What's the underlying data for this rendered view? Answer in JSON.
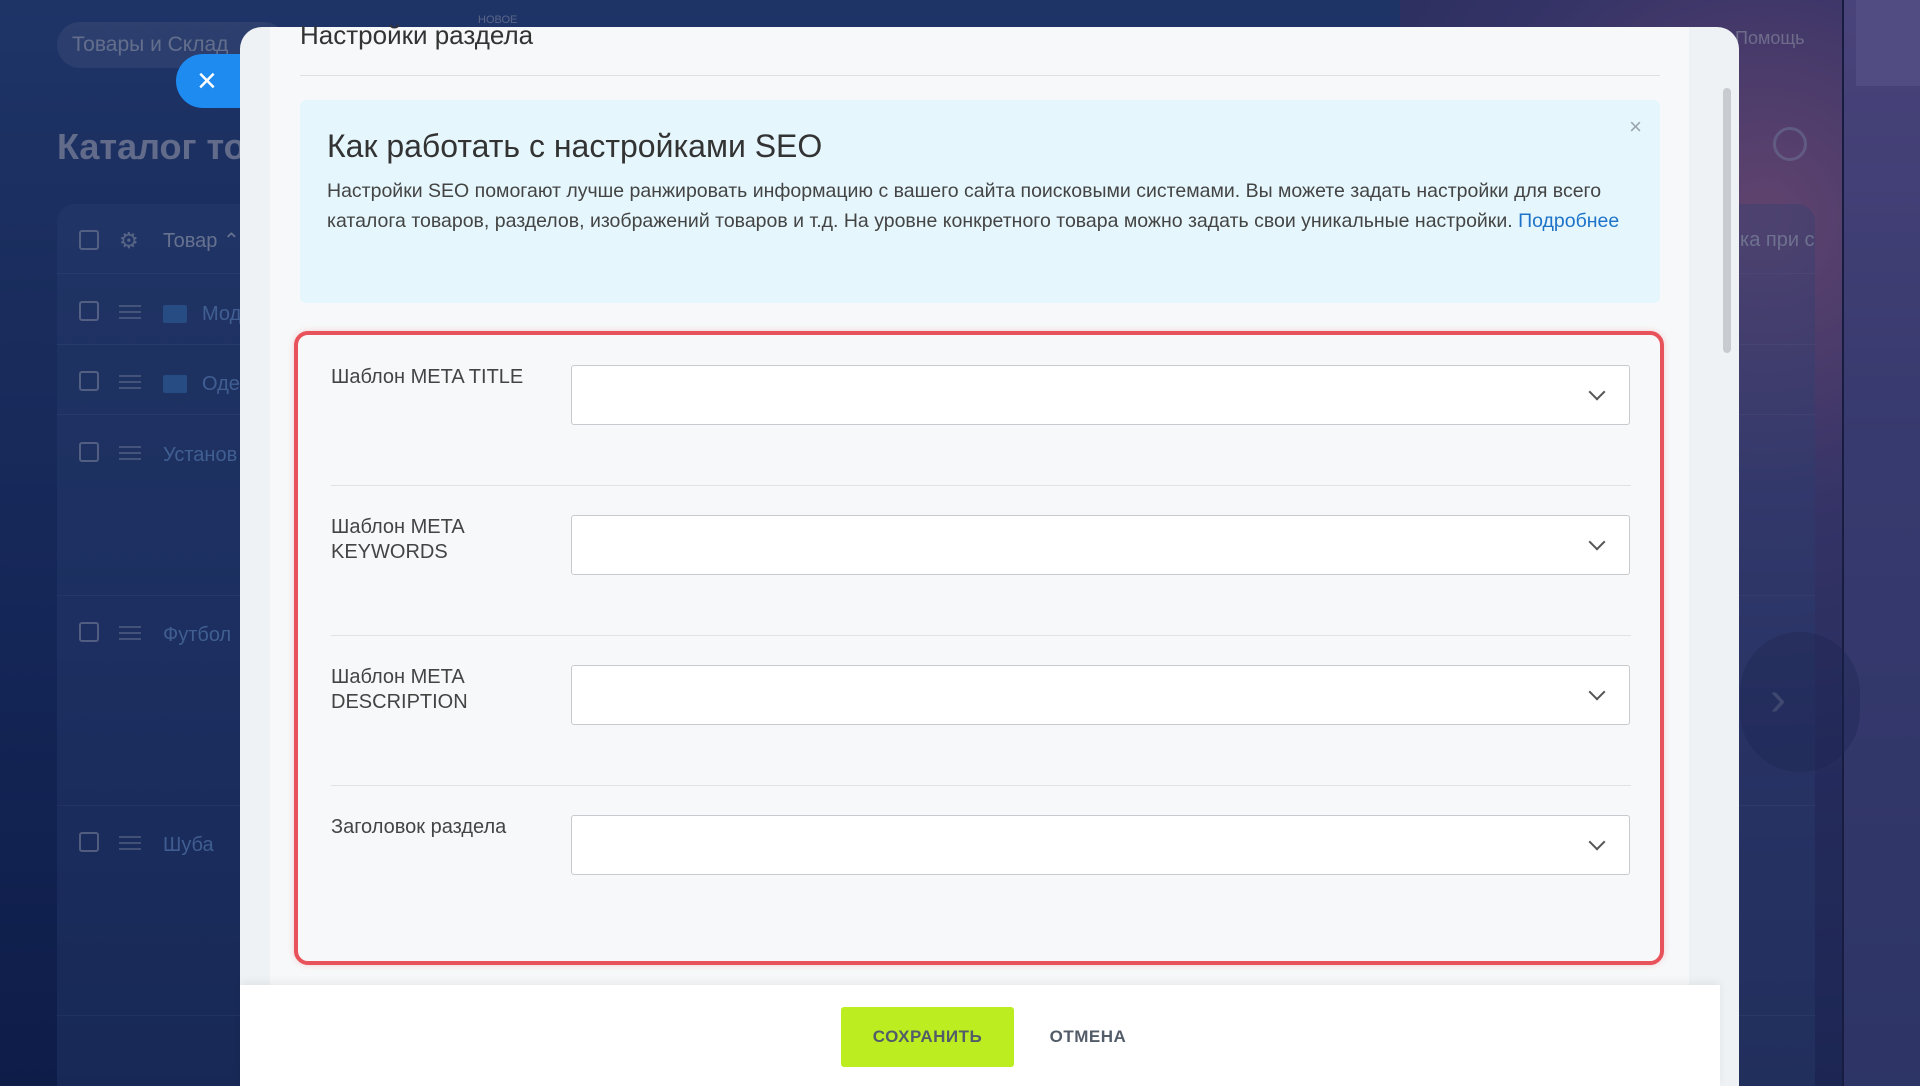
{
  "background": {
    "search_text": "Товары и Склад",
    "new_badge": "НОВОЕ",
    "help_text": "Помощь",
    "page_title": "Каталог то",
    "header": {
      "column_product": "Товар",
      "right_column": "ка при с"
    },
    "rows": [
      {
        "label": "Мод"
      },
      {
        "label": "Оде"
      },
      {
        "label": "Установ"
      },
      {
        "label": "Футбол"
      },
      {
        "label": "Шуба"
      }
    ]
  },
  "close_icon": "×",
  "modal": {
    "section_title": "Настройки раздела",
    "info": {
      "title": "Как работать с настройками SEO",
      "text": "Настройки SEO помогают лучше ранжировать информацию с вашего сайта поисковыми системами. Вы можете задать настройки для всего каталога товаров, разделов, изображений товаров и т.д. На уровне конкретного товара можно задать свои уникальные настройки.",
      "link": "Подробнее",
      "close": "×"
    },
    "fields": [
      {
        "label": "Шаблон META TITLE",
        "value": ""
      },
      {
        "label": "Шаблон META KEYWORDS",
        "value": ""
      },
      {
        "label": "Шаблон META DESCRIPTION",
        "value": ""
      },
      {
        "label": "Заголовок раздела",
        "value": ""
      }
    ],
    "highlight_color": "#e8525a"
  },
  "footer": {
    "save_label": "СОХРАНИТЬ",
    "cancel_label": "ОТМЕНА",
    "save_color": "#bbed21"
  }
}
